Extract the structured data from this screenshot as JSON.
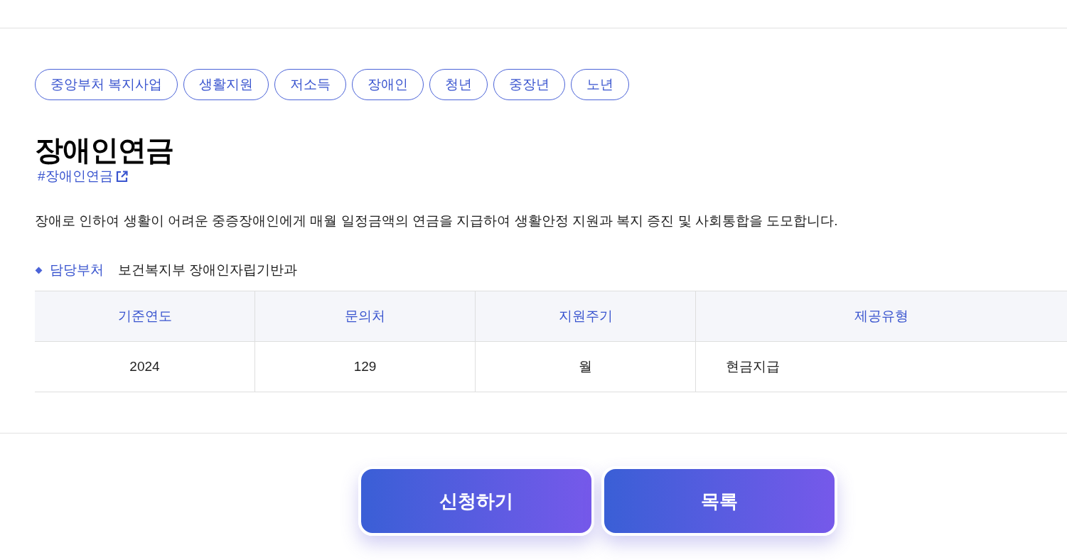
{
  "tags": [
    "중앙부처 복지사업",
    "생활지원",
    "저소득",
    "장애인",
    "청년",
    "중장년",
    "노년"
  ],
  "title": "장애인연금",
  "hashtag": "#장애인연금",
  "description": "장애로 인하여 생활이 어려운 중증장애인에게 매월 일정금액의 연금을 지급하여 생활안정 지원과 복지 증진 및 사회통합을 도모합니다.",
  "department": {
    "label": "담당부처",
    "value": "보건복지부 장애인자립기반과"
  },
  "table": {
    "columns": [
      "기준연도",
      "문의처",
      "지원주기",
      "제공유형"
    ],
    "rows": [
      {
        "cells": [
          "2024",
          "129",
          "월",
          "현금지급"
        ]
      }
    ]
  },
  "buttons": [
    "신청하기",
    "목록"
  ]
}
